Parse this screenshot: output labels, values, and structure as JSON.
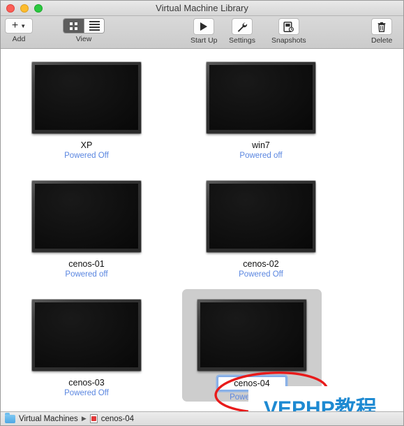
{
  "window": {
    "title": "Virtual Machine Library",
    "traffic_lights": [
      "close-button",
      "minimize-button",
      "maximize-button"
    ]
  },
  "toolbar": {
    "add": {
      "label": "Add",
      "icon": "plus-icon",
      "dropdown_icon": "chevron-down-icon"
    },
    "view": {
      "label": "View",
      "options": [
        {
          "icon": "grid-view-icon",
          "selected": true
        },
        {
          "icon": "list-view-icon",
          "selected": false
        }
      ]
    },
    "startup": {
      "label": "Start Up",
      "icon": "play-icon"
    },
    "settings": {
      "label": "Settings",
      "icon": "wrench-icon"
    },
    "snapshots": {
      "label": "Snapshots",
      "icon": "snapshot-clock-icon"
    },
    "delete": {
      "label": "Delete",
      "icon": "trash-icon"
    }
  },
  "library": {
    "machines": [
      {
        "name": "XP",
        "state": "Powered Off",
        "selected": false,
        "editing": false
      },
      {
        "name": "win7",
        "state": "Powered off",
        "selected": false,
        "editing": false
      },
      {
        "name": "cenos-01",
        "state": "Powered off",
        "selected": false,
        "editing": false
      },
      {
        "name": "cenos-02",
        "state": "Powered Off",
        "selected": false,
        "editing": false
      },
      {
        "name": "cenos-03",
        "state": "Powered Off",
        "selected": false,
        "editing": false
      },
      {
        "name": "cenos-04",
        "state": "Powered Off",
        "selected": true,
        "editing": true
      }
    ]
  },
  "annotation": {
    "shape": "red-ellipse",
    "color": "#e81b1b",
    "target": "cenos-04-name-field"
  },
  "watermark": {
    "text": "VEPHP教程",
    "color": "#1e8ad2"
  },
  "statusbar": {
    "folder_icon": "folder-icon",
    "folder_label": "Virtual Machines",
    "separator": "▶",
    "vm_icon": "vm-file-icon",
    "vm_label": "cenos-04"
  },
  "colors": {
    "link_blue": "#5a86e0",
    "selection_gray": "#cdcdcd",
    "annotation_red": "#e81b1b",
    "watermark_blue": "#1e8ad2"
  }
}
